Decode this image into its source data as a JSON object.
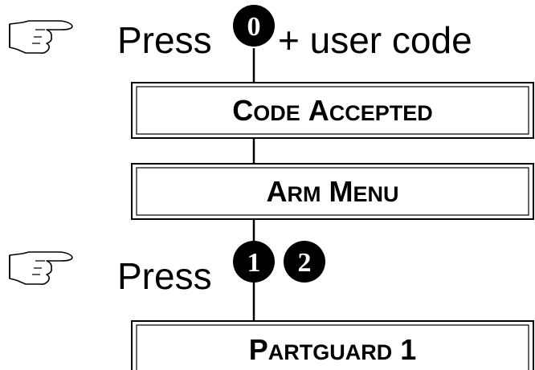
{
  "step1": {
    "press_label": "Press",
    "key": "0",
    "suffix": "+ user code"
  },
  "box1": {
    "first_cap": "C",
    "first_rest": "ODE",
    "second_cap": "A",
    "second_rest": "CCEPTED"
  },
  "box2": {
    "first_cap": "A",
    "first_rest": "RM",
    "second_cap": "M",
    "second_rest": "ENU"
  },
  "step2": {
    "press_label": "Press",
    "keys": [
      "1",
      "2"
    ]
  },
  "box3": {
    "first_cap": "P",
    "first_rest": "ARTGUARD",
    "number": "1"
  },
  "icons": {
    "step1": "pointing-hand-icon",
    "step2": "pointing-hand-icon"
  },
  "colors": {
    "ink": "#000000",
    "background": "#ffffff"
  }
}
